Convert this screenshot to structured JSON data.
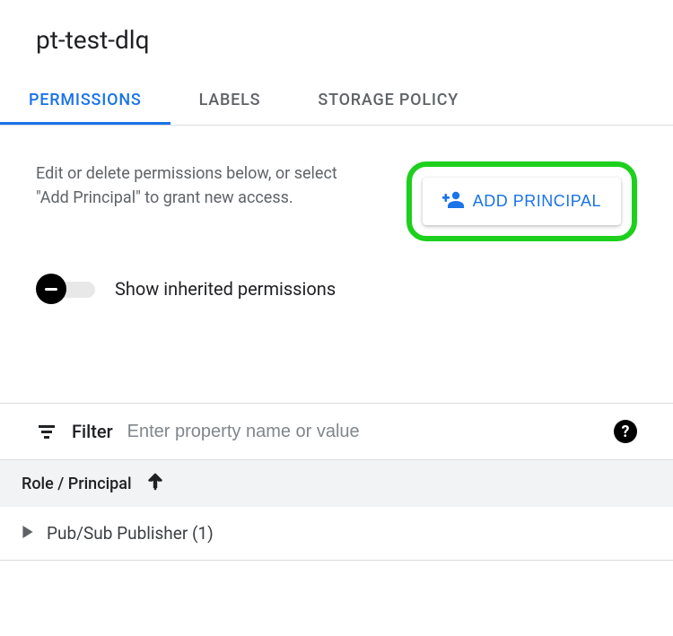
{
  "page": {
    "title": "pt-test-dlq"
  },
  "tabs": {
    "permissions": "PERMISSIONS",
    "labels": "LABELS",
    "storage_policy": "STORAGE POLICY"
  },
  "permissions": {
    "description": "Edit or delete permissions below, or select \"Add Principal\" to grant new access.",
    "add_principal_label": "ADD PRINCIPAL",
    "show_inherited_label": "Show inherited permissions"
  },
  "filter": {
    "label": "Filter",
    "placeholder": "Enter property name or value"
  },
  "table": {
    "header_label": "Role / Principal",
    "rows": [
      {
        "role": "Pub/Sub Publisher (1)"
      }
    ]
  }
}
